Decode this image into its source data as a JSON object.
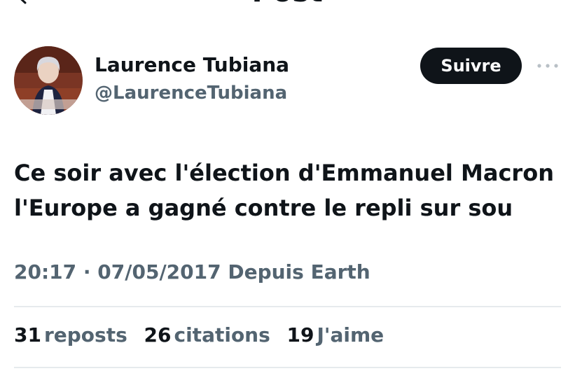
{
  "header": {
    "title": "Post",
    "back_icon": "arrow-left-icon"
  },
  "author": {
    "display_name": "Laurence Tubiana",
    "handle": "@LaurenceTubiana",
    "avatar_icon": "profile-photo"
  },
  "follow_label": "Suivre",
  "more_icon": "more-options-icon",
  "tweet": {
    "lines": [
      "Ce soir avec l'élection d'Emmanuel Macron",
      "l'Europe a gagné contre le repli sur sou"
    ]
  },
  "meta": {
    "time": "20:17",
    "separator": "·",
    "date": "07/05/2017",
    "source": "Depuis Earth"
  },
  "stats": [
    {
      "count": "31",
      "label": "reposts"
    },
    {
      "count": "26",
      "label": "citations"
    },
    {
      "count": "19",
      "label": "J'aime"
    }
  ],
  "colors": {
    "text": "#0f1419",
    "secondary": "#536471",
    "button_bg": "#0f1419",
    "divider": "#e6eaed"
  }
}
